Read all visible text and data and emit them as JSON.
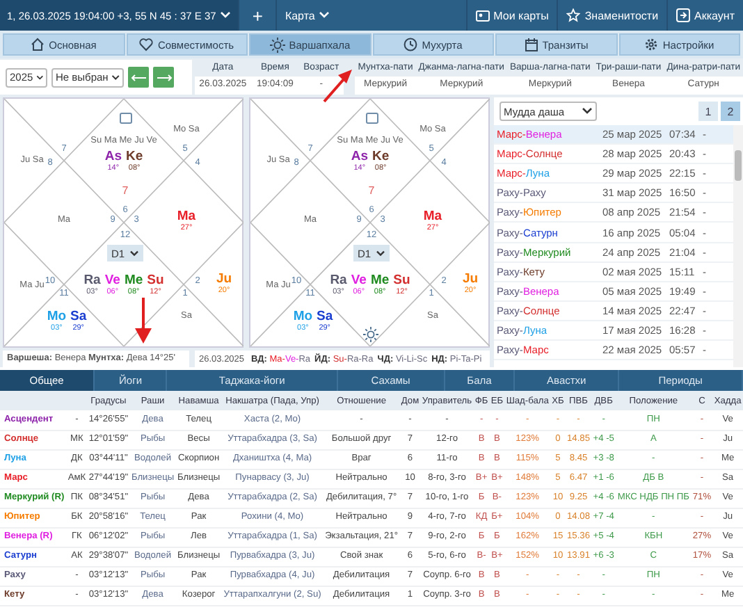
{
  "topbar": {
    "chart_title": "1, 26.03.2025 19:04:00 +3, 55 N 45 : 37 E 37",
    "add": "+",
    "menu": "Карта",
    "links": [
      {
        "label": "Мои карты"
      },
      {
        "label": "Знаменитости"
      },
      {
        "label": "Аккаунт"
      }
    ]
  },
  "tabs": [
    {
      "label": "Основная",
      "selected": false
    },
    {
      "label": "Совместимость",
      "selected": false
    },
    {
      "label": "Варшапхала",
      "selected": true
    },
    {
      "label": "Мухурта",
      "selected": false
    },
    {
      "label": "Транзиты",
      "selected": false
    },
    {
      "label": "Настройки",
      "selected": false
    }
  ],
  "controls": {
    "year": "2025",
    "choice": "Не выбран"
  },
  "info": [
    {
      "label": "Дата",
      "value": "26.03.2025"
    },
    {
      "label": "Время",
      "value": "19:04:09"
    },
    {
      "label": "Возраст",
      "value": "-"
    }
  ],
  "patis": [
    {
      "label": "Мунтха-пати",
      "value": "Меркурий"
    },
    {
      "label": "Джанма-лагна-пати",
      "value": "Меркурий"
    },
    {
      "label": "Варша-лагна-пати",
      "value": "Меркурий"
    },
    {
      "label": "Три-раши-пати",
      "value": "Венера"
    },
    {
      "label": "Дина-ратри-пати",
      "value": "Сатурн"
    }
  ],
  "charts": [
    {
      "division": "D1",
      "sun_toggle": false,
      "houses": [
        {
          "kind": "top-right",
          "sign": "5",
          "aspects": "Mo Sa"
        },
        {
          "kind": "top",
          "sign": "6",
          "aspects": "Su Ma Me Ju Ve",
          "note": "7",
          "planets": [
            {
              "abbr": "As",
              "deg": "14°",
              "color": "#8e24aa"
            },
            {
              "abbr": "Ke",
              "deg": "08°",
              "color": "#6d3b2a"
            }
          ]
        },
        {
          "kind": "top-left",
          "sign": "7"
        },
        {
          "kind": "left-top",
          "sign": "8",
          "aspects": "Ju Sa"
        },
        {
          "kind": "right-top",
          "sign": "4"
        },
        {
          "kind": "left",
          "sign": "9",
          "aspects": "Ma"
        },
        {
          "kind": "right",
          "sign": "3",
          "planets": [
            {
              "abbr": "Ma",
              "deg": "27°",
              "color": "#e8202a"
            }
          ]
        },
        {
          "kind": "bottom",
          "sign": "12",
          "planets": [
            {
              "abbr": "Ra",
              "deg": "03°",
              "color": "#5a5a6e"
            },
            {
              "abbr": "Ve",
              "deg": "06°",
              "color": "#e020e0"
            },
            {
              "abbr": "Me",
              "deg": "08°",
              "color": "#1f8a1f"
            },
            {
              "abbr": "Su",
              "deg": "12°",
              "color": "#d32f2f"
            }
          ]
        },
        {
          "kind": "left-bottom",
          "sign": "10",
          "aspects": "Ma Ju"
        },
        {
          "kind": "right-bottom",
          "sign": "2",
          "planets": [
            {
              "abbr": "Ju",
              "deg": "20°",
              "color": "#f57c00"
            }
          ]
        },
        {
          "kind": "bottom-left",
          "sign": "11",
          "planets": [
            {
              "abbr": "Mo",
              "deg": "03°",
              "color": "#1ea0e6"
            },
            {
              "abbr": "Sa",
              "deg": "29°",
              "color": "#1a3ed0"
            }
          ]
        },
        {
          "kind": "bottom-right",
          "sign": "1",
          "aspects": "Sa"
        }
      ]
    },
    {
      "division": "D1",
      "sun_toggle": true,
      "houses": [
        {
          "kind": "top-right",
          "sign": "5",
          "aspects": "Mo Sa"
        },
        {
          "kind": "top",
          "sign": "6",
          "aspects": "Su Ma Me Ju Ve",
          "note": "7",
          "planets": [
            {
              "abbr": "As",
              "deg": "14°",
              "color": "#8e24aa"
            },
            {
              "abbr": "Ke",
              "deg": "08°",
              "color": "#6d3b2a"
            }
          ]
        },
        {
          "kind": "top-left",
          "sign": "7"
        },
        {
          "kind": "left-top",
          "sign": "8",
          "aspects": "Ju Sa"
        },
        {
          "kind": "right-top",
          "sign": "4"
        },
        {
          "kind": "left",
          "sign": "9",
          "aspects": "Ma"
        },
        {
          "kind": "right",
          "sign": "3",
          "planets": [
            {
              "abbr": "Ma",
              "deg": "27°",
              "color": "#e8202a"
            }
          ]
        },
        {
          "kind": "bottom",
          "sign": "12",
          "planets": [
            {
              "abbr": "Ra",
              "deg": "03°",
              "color": "#5a5a6e"
            },
            {
              "abbr": "Ve",
              "deg": "06°",
              "color": "#e020e0"
            },
            {
              "abbr": "Me",
              "deg": "08°",
              "color": "#1f8a1f"
            },
            {
              "abbr": "Su",
              "deg": "12°",
              "color": "#d32f2f"
            }
          ]
        },
        {
          "kind": "left-bottom",
          "sign": "10",
          "aspects": "Ma Ju"
        },
        {
          "kind": "right-bottom",
          "sign": "2",
          "planets": [
            {
              "abbr": "Ju",
              "deg": "20°",
              "color": "#f57c00"
            }
          ]
        },
        {
          "kind": "bottom-left",
          "sign": "11",
          "planets": [
            {
              "abbr": "Mo",
              "deg": "03°",
              "color": "#1ea0e6"
            },
            {
              "abbr": "Sa",
              "deg": "29°",
              "color": "#1a3ed0"
            }
          ]
        },
        {
          "kind": "bottom-right",
          "sign": "1",
          "aspects": "Sa"
        }
      ]
    }
  ],
  "summary": "**Варшеша:** Венера **Мунтха:** Дева 14°25'",
  "dashas": {
    "date": "26.03.2025",
    "items": [
      {
        "label": "ВД:",
        "parts": [
          {
            "text": "Ma-",
            "color": "#e8202a"
          },
          {
            "text": "Ve-",
            "color": "#e020e0"
          },
          {
            "text": "Ra",
            "color": "#6a6a7e"
          }
        ]
      },
      {
        "label": "ЙД:",
        "parts": [
          {
            "text": "Su-",
            "color": "#d32f2f"
          },
          {
            "text": "Ra-Ra",
            "color": "#6a6a7e"
          }
        ]
      },
      {
        "label": "ЧД:",
        "parts": [
          {
            "text": "Vi-Li-Sc",
            "color": "#6a6a7e"
          }
        ]
      },
      {
        "label": "НД:",
        "parts": [
          {
            "text": "Pi-Ta-Pi",
            "color": "#6a6a7e"
          }
        ]
      }
    ]
  },
  "dasha_panel": {
    "select": "Мудда даша",
    "pages": [
      {
        "label": "1",
        "selected": false
      },
      {
        "label": "2",
        "selected": true
      }
    ],
    "rows": [
      {
        "selected": true,
        "parts": [
          {
            "text": "Марс-",
            "color": "#e8202a"
          },
          {
            "text": "Венера",
            "color": "#e020e0"
          }
        ],
        "date": "25 мар 2025",
        "time": "07:34",
        "mark": "-"
      },
      {
        "selected": false,
        "parts": [
          {
            "text": "Марс-",
            "color": "#e8202a"
          },
          {
            "text": "Солнце",
            "color": "#d32f2f"
          }
        ],
        "date": "28 мар 2025",
        "time": "20:43",
        "mark": "-"
      },
      {
        "selected": false,
        "parts": [
          {
            "text": "Марс-",
            "color": "#e8202a"
          },
          {
            "text": "Луна",
            "color": "#1ea0e6"
          }
        ],
        "date": "29 мар 2025",
        "time": "22:15",
        "mark": "-"
      },
      {
        "selected": false,
        "parts": [
          {
            "text": "Раху-",
            "color": "#5a5a78"
          },
          {
            "text": "Раху",
            "color": "#5a5a78"
          }
        ],
        "date": "31 мар 2025",
        "time": "16:50",
        "mark": "-"
      },
      {
        "selected": false,
        "parts": [
          {
            "text": "Раху-",
            "color": "#5a5a78"
          },
          {
            "text": "Юпитер",
            "color": "#f57c00"
          }
        ],
        "date": "08 апр 2025",
        "time": "21:54",
        "mark": "-"
      },
      {
        "selected": false,
        "parts": [
          {
            "text": "Раху-",
            "color": "#5a5a78"
          },
          {
            "text": "Сатурн",
            "color": "#1a3ed0"
          }
        ],
        "date": "16 апр 2025",
        "time": "05:04",
        "mark": "-"
      },
      {
        "selected": false,
        "parts": [
          {
            "text": "Раху-",
            "color": "#5a5a78"
          },
          {
            "text": "Меркурий",
            "color": "#1f8a1f"
          }
        ],
        "date": "24 апр 2025",
        "time": "21:04",
        "mark": "-"
      },
      {
        "selected": false,
        "parts": [
          {
            "text": "Раху-",
            "color": "#5a5a78"
          },
          {
            "text": "Кету",
            "color": "#6d3b2a"
          }
        ],
        "date": "02 мая 2025",
        "time": "15:11",
        "mark": "-"
      },
      {
        "selected": false,
        "parts": [
          {
            "text": "Раху-",
            "color": "#5a5a78"
          },
          {
            "text": "Венера",
            "color": "#e020e0"
          }
        ],
        "date": "05 мая 2025",
        "time": "19:49",
        "mark": "-"
      },
      {
        "selected": false,
        "parts": [
          {
            "text": "Раху-",
            "color": "#5a5a78"
          },
          {
            "text": "Солнце",
            "color": "#d32f2f"
          }
        ],
        "date": "14 мая 2025",
        "time": "22:47",
        "mark": "-"
      },
      {
        "selected": false,
        "parts": [
          {
            "text": "Раху-",
            "color": "#5a5a78"
          },
          {
            "text": "Луна",
            "color": "#1ea0e6"
          }
        ],
        "date": "17 мая 2025",
        "time": "16:28",
        "mark": "-"
      },
      {
        "selected": false,
        "parts": [
          {
            "text": "Раху-",
            "color": "#5a5a78"
          },
          {
            "text": "Марс",
            "color": "#e8202a"
          }
        ],
        "date": "22 мая 2025",
        "time": "05:57",
        "mark": "-"
      }
    ]
  },
  "section_tabs": [
    {
      "label": "Общее",
      "selected": true
    },
    {
      "label": "Йоги",
      "selected": false
    },
    {
      "label": "Таджака-йоги",
      "selected": false
    },
    {
      "label": "Сахамы",
      "selected": false
    },
    {
      "label": "Бала",
      "selected": false
    },
    {
      "label": "Авастхи",
      "selected": false
    },
    {
      "label": "Периоды",
      "selected": false
    }
  ],
  "table": {
    "columns": [
      "",
      "",
      "Градусы",
      "Раши",
      "Навамша",
      "Накшатра (Пада, Упр)",
      "Отношение",
      "Дом",
      "Управитель",
      "ФБ",
      "ЕБ",
      "Шад-бала",
      "ХБ",
      "ПВБ",
      "ДВБ",
      "Положение",
      "С",
      "Хадда"
    ],
    "rows": [
      {
        "color": "#8e24aa",
        "cells": [
          "Асцендент",
          "-",
          "14°26'55\"",
          "Дева",
          "Телец",
          "Хаста (2, Mo)",
          "-",
          "-",
          "-",
          "-",
          "-",
          "-",
          "-",
          "-",
          "-",
          "ПН",
          "-",
          "Ve"
        ]
      },
      {
        "color": "#d32f2f",
        "cells": [
          "Солнце",
          "МК",
          "12°01'59\"",
          "Рыбы",
          "Весы",
          "Уттарабхадра (3, Sa)",
          "Большой друг",
          "7",
          "12-го",
          "В",
          "В",
          "123%",
          "0",
          "14.85",
          "+4 -5",
          "А",
          "-",
          "Ju"
        ]
      },
      {
        "color": "#1ea0e6",
        "cells": [
          "Луна",
          "ДК",
          "03°44'11\"",
          "Водолей",
          "Скорпион",
          "Дхаништха (4, Ma)",
          "Враг",
          "6",
          "11-го",
          "В",
          "В",
          "115%",
          "5",
          "8.45",
          "+3 -8",
          "-",
          "-",
          "Me"
        ]
      },
      {
        "color": "#e8202a",
        "cells": [
          "Марс",
          "АмК",
          "27°44'19\"",
          "Близнецы",
          "Близнецы",
          "Пунарвасу (3, Ju)",
          "Нейтрально",
          "10",
          "8-го, 3-го",
          "В+",
          "В+",
          "148%",
          "5",
          "6.47",
          "+1 -6",
          "ДБ В",
          "-",
          "Sa"
        ]
      },
      {
        "color": "#1f8a1f",
        "cells": [
          "Меркурий (R)",
          "ПК",
          "08°34'51\"",
          "Рыбы",
          "Дева",
          "Уттарабхадра (2, Sa)",
          "Дебилитация, 7°",
          "7",
          "10-го, 1-го",
          "Б",
          "В-",
          "123%",
          "10",
          "9.25",
          "+4 -6",
          "МКС НДБ ПН ПБ",
          "71%",
          "Ve"
        ]
      },
      {
        "color": "#f57c00",
        "cells": [
          "Юпитер",
          "БК",
          "20°58'16\"",
          "Телец",
          "Рак",
          "Рохини (4, Mo)",
          "Нейтрально",
          "9",
          "4-го, 7-го",
          "КД",
          "Б+",
          "104%",
          "0",
          "14.08",
          "+7 -4",
          "-",
          "-",
          "Ju"
        ]
      },
      {
        "color": "#e020e0",
        "cells": [
          "Венера (R)",
          "ГК",
          "06°12'02\"",
          "Рыбы",
          "Лев",
          "Уттарабхадра (1, Sa)",
          "Экзальтация, 21°",
          "7",
          "9-го, 2-го",
          "Б",
          "Б",
          "162%",
          "15",
          "15.36",
          "+5 -4",
          "КБН",
          "27%",
          "Ve"
        ]
      },
      {
        "color": "#1a3ed0",
        "cells": [
          "Сатурн",
          "АК",
          "29°38'07\"",
          "Водолей",
          "Близнецы",
          "Пурвабхадра (3, Ju)",
          "Свой знак",
          "6",
          "5-го, 6-го",
          "В-",
          "В+",
          "152%",
          "10",
          "13.91",
          "+6 -3",
          "С",
          "17%",
          "Sa"
        ]
      },
      {
        "color": "#5a5a78",
        "cells": [
          "Раху",
          "-",
          "03°12'13\"",
          "Рыбы",
          "Рак",
          "Пурвабхадра (4, Ju)",
          "Дебилитация",
          "7",
          "Соупр. 6-го",
          "В",
          "В",
          "-",
          "-",
          "-",
          "-",
          "ПН",
          "-",
          "Ve"
        ]
      },
      {
        "color": "#6d3b2a",
        "cells": [
          "Кету",
          "-",
          "03°12'13\"",
          "Дева",
          "Козерог",
          "Уттарапхалгуни (2, Su)",
          "Дебилитация",
          "1",
          "Соупр. 3-го",
          "В",
          "В",
          "-",
          "-",
          "-",
          "-",
          "-",
          "-",
          "Me"
        ]
      }
    ]
  }
}
